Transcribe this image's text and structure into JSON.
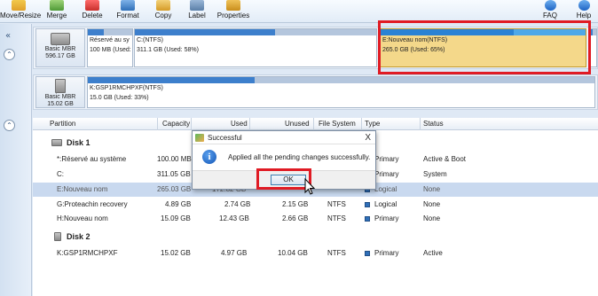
{
  "toolbar": {
    "items": [
      {
        "label": "Move/Resize",
        "icon": "move-resize-icon"
      },
      {
        "label": "Merge",
        "icon": "merge-icon"
      },
      {
        "label": "Delete",
        "icon": "delete-icon"
      },
      {
        "label": "Format",
        "icon": "format-icon"
      },
      {
        "label": "Copy",
        "icon": "copy-icon"
      },
      {
        "label": "Label",
        "icon": "label-icon"
      },
      {
        "label": "Properties",
        "icon": "properties-icon"
      },
      {
        "label": "FAQ",
        "icon": "faq-icon"
      },
      {
        "label": "Help",
        "icon": "help-icon"
      }
    ]
  },
  "disk1": {
    "type": "Basic MBR",
    "size": "596.17 GB",
    "partitions": [
      {
        "name": "Réservé au sy",
        "info": "100 MB (Used:"
      },
      {
        "name": "C:(NTFS)",
        "info": "311.1 GB (Used: 58%)"
      },
      {
        "name": "E:Nouveau nom(NTFS)",
        "info": "265.0 GB (Used: 65%)"
      }
    ]
  },
  "disk2": {
    "type": "Basic MBR",
    "size": "15.02 GB",
    "partitions": [
      {
        "name": "K:GSP1RMCHPXF(NTFS)",
        "info": "15.0 GB (Used: 33%)"
      }
    ]
  },
  "table": {
    "headers": {
      "partition": "Partition",
      "capacity": "Capacity",
      "used": "Used",
      "unused": "Unused",
      "filesystem": "File System",
      "type": "Type",
      "status": "Status"
    },
    "groups": [
      {
        "name": "Disk 1",
        "rows": [
          {
            "partition": "*:Réservé au système",
            "capacity": "100.00 MB",
            "used": "",
            "unused": "",
            "fs": "",
            "type": "Primary",
            "status": "Active & Boot"
          },
          {
            "partition": "C:",
            "capacity": "311.05 GB",
            "used": "",
            "unused": "",
            "fs": "",
            "type": "Primary",
            "status": "System"
          },
          {
            "partition": "E:Nouveau nom",
            "capacity": "265.03 GB",
            "used": "172.82 GB",
            "unused": "",
            "fs": "",
            "type": "Logical",
            "status": "None"
          },
          {
            "partition": "G:Proteachin recovery",
            "capacity": "4.89 GB",
            "used": "2.74 GB",
            "unused": "2.15 GB",
            "fs": "NTFS",
            "type": "Logical",
            "status": "None"
          },
          {
            "partition": "H:Nouveau nom",
            "capacity": "15.09 GB",
            "used": "12.43 GB",
            "unused": "2.66 GB",
            "fs": "NTFS",
            "type": "Primary",
            "status": "None"
          }
        ]
      },
      {
        "name": "Disk 2",
        "rows": [
          {
            "partition": "K:GSP1RMCHPXF",
            "capacity": "15.02 GB",
            "used": "4.97 GB",
            "unused": "10.04 GB",
            "fs": "NTFS",
            "type": "Primary",
            "status": "Active"
          }
        ]
      }
    ]
  },
  "dialog": {
    "title": "Successful",
    "close": "X",
    "message": "Applied all the pending changes successfully.",
    "ok_label": "OK",
    "info_glyph": "i"
  },
  "left": {
    "collapse_glyph": "«",
    "up_glyph": "⌃"
  },
  "colors": {
    "selected_partition": "#f4d88a",
    "used_bar": "#3d7fcc",
    "highlight_box": "#e01b24"
  }
}
